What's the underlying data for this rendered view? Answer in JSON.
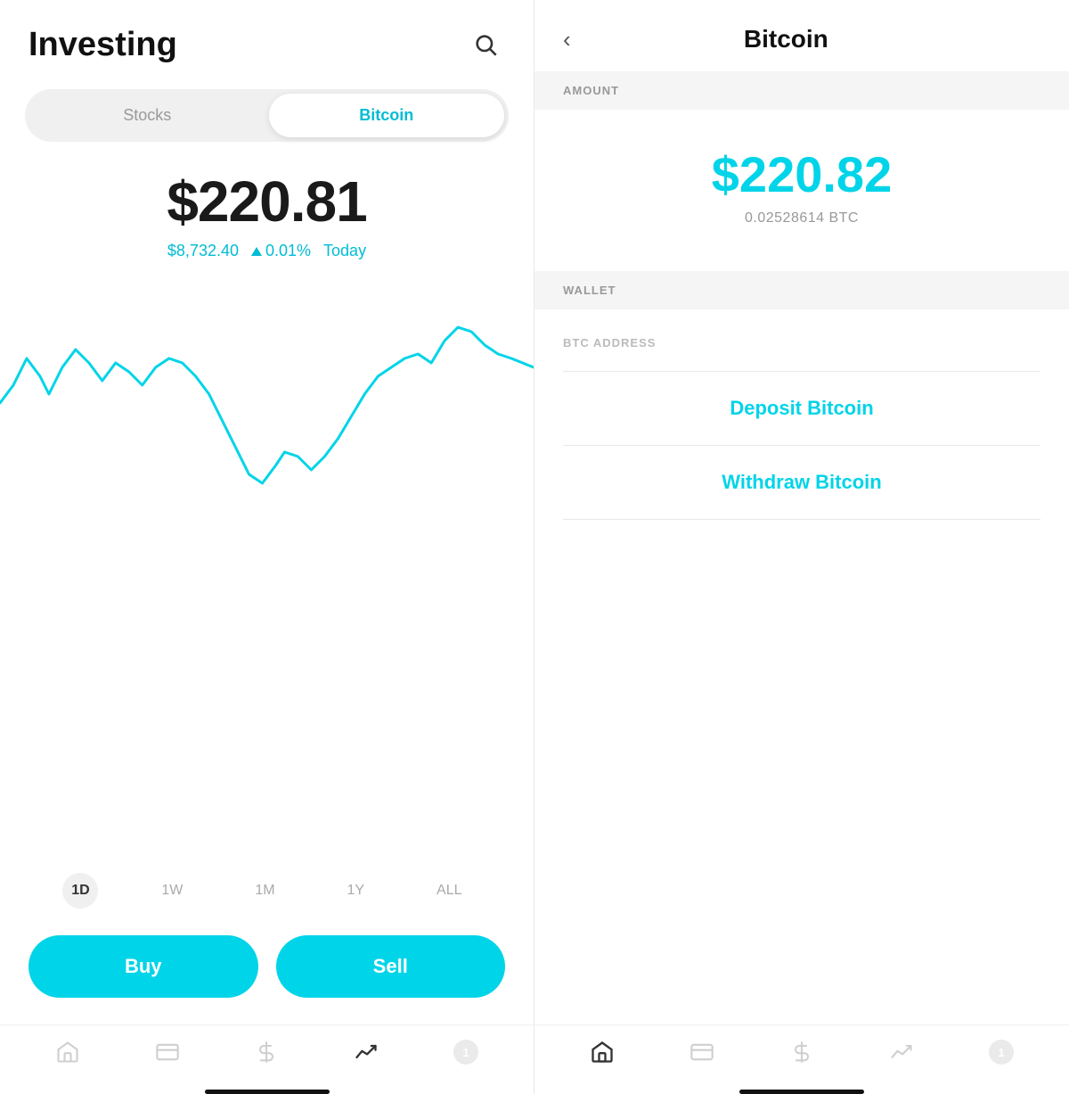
{
  "left": {
    "title": "Investing",
    "tabs": [
      {
        "label": "Stocks",
        "active": false
      },
      {
        "label": "Bitcoin",
        "active": true
      }
    ],
    "price": {
      "main": "$220.81",
      "sub": "$8,732.40",
      "change": "0.01%",
      "period": "Today"
    },
    "timeRanges": [
      {
        "label": "1D",
        "active": true
      },
      {
        "label": "1W",
        "active": false
      },
      {
        "label": "1M",
        "active": false
      },
      {
        "label": "1Y",
        "active": false
      },
      {
        "label": "ALL",
        "active": false
      }
    ],
    "buttons": {
      "buy": "Buy",
      "sell": "Sell"
    },
    "nav": [
      {
        "icon": "home",
        "label": "home"
      },
      {
        "icon": "news",
        "label": "news"
      },
      {
        "icon": "dollar",
        "label": "cash"
      },
      {
        "icon": "investing",
        "label": "investing",
        "active": true
      },
      {
        "icon": "badge",
        "label": "notifications",
        "count": "1"
      }
    ]
  },
  "right": {
    "back_label": "‹",
    "title": "Bitcoin",
    "sections": {
      "amount_header": "AMOUNT",
      "wallet_header": "WALLET"
    },
    "amount": {
      "value": "$220.82",
      "btc": "0.02528614 BTC"
    },
    "wallet": {
      "btc_address_label": "BTC ADDRESS"
    },
    "actions": {
      "deposit": "Deposit Bitcoin",
      "withdraw": "Withdraw Bitcoin"
    },
    "nav": [
      {
        "icon": "home",
        "label": "home",
        "active": true
      },
      {
        "icon": "news",
        "label": "news"
      },
      {
        "icon": "dollar",
        "label": "cash"
      },
      {
        "icon": "investing",
        "label": "investing"
      },
      {
        "icon": "badge",
        "label": "notifications",
        "count": "1"
      }
    ]
  }
}
